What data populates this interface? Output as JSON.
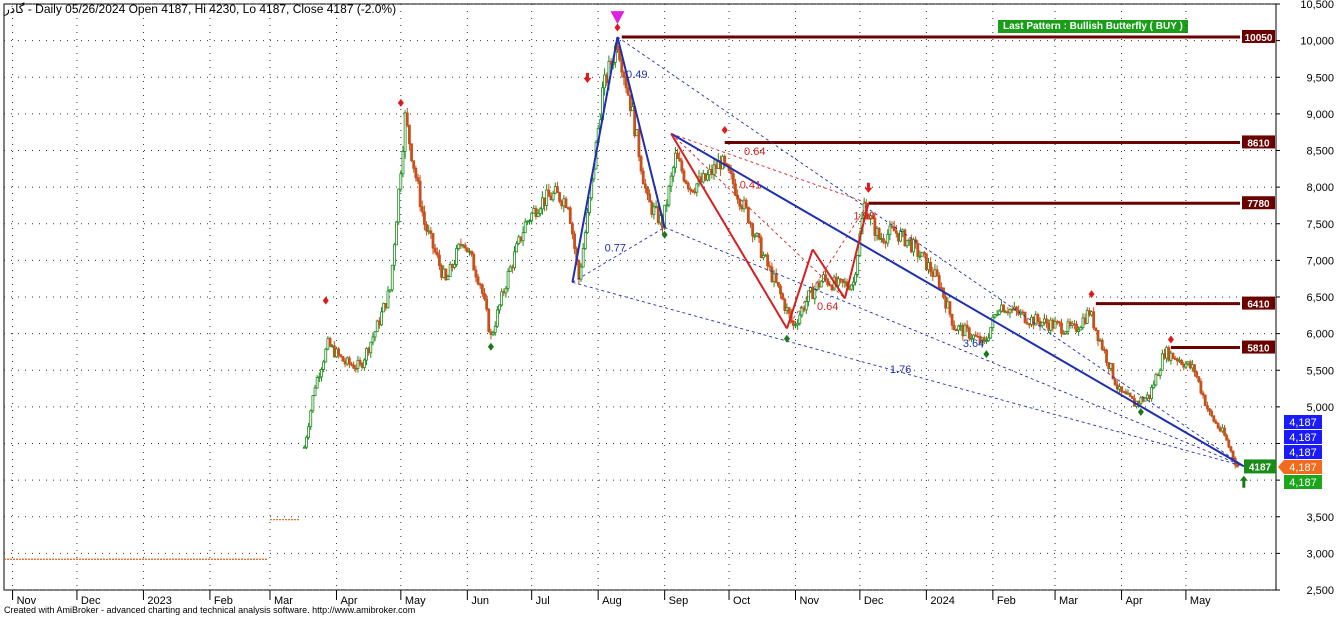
{
  "header": {
    "symbol": "گاذر",
    "info": " - Daily 05/26/2024 Open 4187, Hi 4230, Lo 4187, Close 4187 (-2.0%)"
  },
  "footer": "Created with AmiBroker - advanced charting and technical analysis software. http://www.amibroker.com",
  "pattern_label": "Last Pattern : Bullish Butterfly ( BUY )",
  "colors": {
    "candle": "#1a8c1a",
    "pattern_blue": "#1f2fb0",
    "pattern_red": "#d42020",
    "level_line": "#6b0000",
    "marker_red": "#e01818",
    "marker_green": "#1a7a1a",
    "marker_magenta": "#e020e0"
  },
  "chart_data": {
    "type": "candlestick",
    "ylim": [
      2500,
      10500
    ],
    "yticks": [
      2500,
      3000,
      3500,
      4000,
      4500,
      5000,
      5500,
      6000,
      6500,
      7000,
      7500,
      8000,
      8500,
      9000,
      9500,
      10000,
      10500
    ],
    "ytick_labels": [
      "2,500",
      "3,000",
      "3,500",
      "",
      "",
      "5,000",
      "5,500",
      "6,000",
      "6,500",
      "7,000",
      "7,500",
      "8,000",
      "8,500",
      "9,000",
      "9,500",
      "10,000",
      "10,500"
    ],
    "x_labels": [
      "Nov",
      "Dec",
      "2023",
      "Feb",
      "Mar",
      "Apr",
      "May",
      "Jun",
      "Jul",
      "Aug",
      "Sep",
      "Oct",
      "Nov",
      "Dec",
      "2024",
      "Feb",
      "Mar",
      "Apr",
      "May"
    ],
    "x_label_dates": [
      "2022-11-01",
      "2022-12-01",
      "2023-01-01",
      "2023-02-01",
      "2023-03-01",
      "2023-04-01",
      "2023-05-01",
      "2023-06-01",
      "2023-07-01",
      "2023-08-01",
      "2023-09-01",
      "2023-10-01",
      "2023-11-01",
      "2023-12-01",
      "2024-01-01",
      "2024-02-01",
      "2024-03-01",
      "2024-04-01",
      "2024-05-01"
    ],
    "x_range": [
      "2022-10-28",
      "2024-06-12"
    ],
    "close_path": [
      [
        "2022-10-28",
        2920
      ],
      [
        "2023-02-28",
        2920
      ],
      [
        "2023-03-01",
        3460
      ],
      [
        "2023-03-15",
        3460
      ],
      [
        "2023-03-17",
        4450
      ],
      [
        "2023-03-22",
        5300
      ],
      [
        "2023-03-28",
        5850
      ],
      [
        "2023-04-05",
        5600
      ],
      [
        "2023-04-12",
        5550
      ],
      [
        "2023-04-20",
        6100
      ],
      [
        "2023-04-26",
        6600
      ],
      [
        "2023-05-03",
        8950
      ],
      [
        "2023-05-12",
        7500
      ],
      [
        "2023-05-22",
        6700
      ],
      [
        "2023-05-30",
        7300
      ],
      [
        "2023-06-07",
        6700
      ],
      [
        "2023-06-12",
        5950
      ],
      [
        "2023-06-20",
        6800
      ],
      [
        "2023-06-28",
        7500
      ],
      [
        "2023-07-05",
        7800
      ],
      [
        "2023-07-12",
        7900
      ],
      [
        "2023-07-18",
        7800
      ],
      [
        "2023-07-23",
        6750
      ],
      [
        "2023-07-28",
        7800
      ],
      [
        "2023-08-03",
        9300
      ],
      [
        "2023-08-10",
        10000
      ],
      [
        "2023-08-17",
        9000
      ],
      [
        "2023-08-24",
        7800
      ],
      [
        "2023-08-31",
        7500
      ],
      [
        "2023-09-06",
        8400
      ],
      [
        "2023-09-13",
        8000
      ],
      [
        "2023-09-20",
        8100
      ],
      [
        "2023-09-27",
        8350
      ],
      [
        "2023-10-03",
        8050
      ],
      [
        "2023-10-10",
        7600
      ],
      [
        "2023-10-17",
        7050
      ],
      [
        "2023-10-24",
        6600
      ],
      [
        "2023-10-31",
        6100
      ],
      [
        "2023-11-07",
        6500
      ],
      [
        "2023-11-14",
        6750
      ],
      [
        "2023-11-21",
        6650
      ],
      [
        "2023-11-28",
        6700
      ],
      [
        "2023-12-03",
        7750
      ],
      [
        "2023-12-10",
        7300
      ],
      [
        "2023-12-17",
        7400
      ],
      [
        "2023-12-24",
        7250
      ],
      [
        "2023-12-31",
        7000
      ],
      [
        "2024-01-07",
        6700
      ],
      [
        "2024-01-14",
        6100
      ],
      [
        "2024-01-21",
        6000
      ],
      [
        "2024-01-28",
        5850
      ],
      [
        "2024-02-04",
        6400
      ],
      [
        "2024-02-11",
        6300
      ],
      [
        "2024-02-18",
        6200
      ],
      [
        "2024-02-25",
        6150
      ],
      [
        "2024-03-03",
        6100
      ],
      [
        "2024-03-10",
        6050
      ],
      [
        "2024-03-17",
        6300
      ],
      [
        "2024-03-24",
        5750
      ],
      [
        "2024-03-31",
        5200
      ],
      [
        "2024-04-07",
        5050
      ],
      [
        "2024-04-14",
        5150
      ],
      [
        "2024-04-21",
        5750
      ],
      [
        "2024-04-28",
        5650
      ],
      [
        "2024-05-05",
        5500
      ],
      [
        "2024-05-12",
        4900
      ],
      [
        "2024-05-19",
        4600
      ],
      [
        "2024-05-25",
        4187
      ]
    ],
    "pattern_lines_blue": [
      [
        "2023-07-20",
        6700,
        "2023-08-10",
        10050
      ],
      [
        "2023-08-10",
        10050,
        "2023-09-01",
        7450
      ],
      [
        "2023-09-04",
        8730,
        "2024-05-28",
        4190
      ]
    ],
    "pattern_lines_red": [
      [
        "2023-09-04",
        8730,
        "2023-10-28",
        6070
      ],
      [
        "2023-10-28",
        6070,
        "2023-11-09",
        7150
      ],
      [
        "2023-11-09",
        7150,
        "2023-11-24",
        6480
      ],
      [
        "2023-11-24",
        6480,
        "2023-12-05",
        7780
      ]
    ],
    "pattern_dashed_blue": [
      [
        "2023-08-10",
        10050,
        "2024-05-28",
        4190
      ],
      [
        "2023-07-20",
        6700,
        "2024-05-28",
        4190
      ],
      [
        "2023-07-20",
        6700,
        "2023-09-01",
        7450
      ],
      [
        "2023-09-01",
        7450,
        "2024-05-28",
        4190
      ]
    ],
    "pattern_dashed_red": [
      [
        "2023-09-04",
        8730,
        "2023-12-05",
        7780
      ],
      [
        "2023-09-04",
        8730,
        "2023-11-24",
        6480
      ],
      [
        "2023-10-28",
        6070,
        "2023-12-05",
        7780
      ]
    ],
    "ratio_labels": [
      {
        "text": "0.49",
        "date": "2023-08-14",
        "value": 9490,
        "color": "blue"
      },
      {
        "text": "0.77",
        "date": "2023-08-04",
        "value": 7120,
        "color": "blue"
      },
      {
        "text": "0.64",
        "date": "2023-10-08",
        "value": 8440,
        "color": "red"
      },
      {
        "text": "0.41",
        "date": "2023-10-06",
        "value": 7980,
        "color": "red"
      },
      {
        "text": "1.90",
        "date": "2023-11-28",
        "value": 7560,
        "color": "red"
      },
      {
        "text": "0.64",
        "date": "2023-11-11",
        "value": 6320,
        "color": "red"
      },
      {
        "text": "3.64",
        "date": "2024-01-18",
        "value": 5820,
        "color": "blue"
      },
      {
        "text": "1.76",
        "date": "2023-12-15",
        "value": 5460,
        "color": "blue"
      }
    ],
    "levels": [
      {
        "value": 10050,
        "start": "2023-08-12",
        "label": "10050"
      },
      {
        "value": 8610,
        "start": "2023-09-29",
        "label": "8610"
      },
      {
        "value": 7780,
        "start": "2023-12-05",
        "label": "7780"
      },
      {
        "value": 6410,
        "start": "2024-03-20",
        "label": "6410"
      },
      {
        "value": 5810,
        "start": "2024-04-24",
        "label": "5810"
      }
    ],
    "markers_red_up": [
      {
        "date": "2023-03-27",
        "value": 6450
      },
      {
        "date": "2023-05-01",
        "value": 9150
      },
      {
        "date": "2023-08-10",
        "value": 10180
      },
      {
        "date": "2023-09-29",
        "value": 8780
      },
      {
        "date": "2024-03-18",
        "value": 6540
      },
      {
        "date": "2024-04-24",
        "value": 5920
      }
    ],
    "markers_green_down": [
      {
        "date": "2023-06-12",
        "value": 5820
      },
      {
        "date": "2023-09-01",
        "value": 7350
      },
      {
        "date": "2023-10-28",
        "value": 5930
      },
      {
        "date": "2024-01-29",
        "value": 5720
      },
      {
        "date": "2024-04-10",
        "value": 4930
      }
    ],
    "arrows_red_down": [
      {
        "date": "2023-07-27",
        "value": 9450
      },
      {
        "date": "2023-12-05",
        "value": 7950
      }
    ],
    "arrow_magenta": {
      "date": "2023-08-10",
      "value": 10280
    },
    "arrow_green_up": {
      "date": "2024-05-28",
      "value": 3950
    },
    "right_badges": [
      {
        "text": "4,187",
        "color": "#1a1aff",
        "row": 0
      },
      {
        "text": "4,187",
        "color": "#1a1aff",
        "row": 1
      },
      {
        "text": "4,187",
        "color": "#1a1aff",
        "row": 2
      },
      {
        "text": "4,187",
        "color": "#f26a1b",
        "row": 3
      },
      {
        "text": "4,187",
        "color": "#1aa81a",
        "row": 4
      }
    ],
    "price_badge": "4187"
  }
}
